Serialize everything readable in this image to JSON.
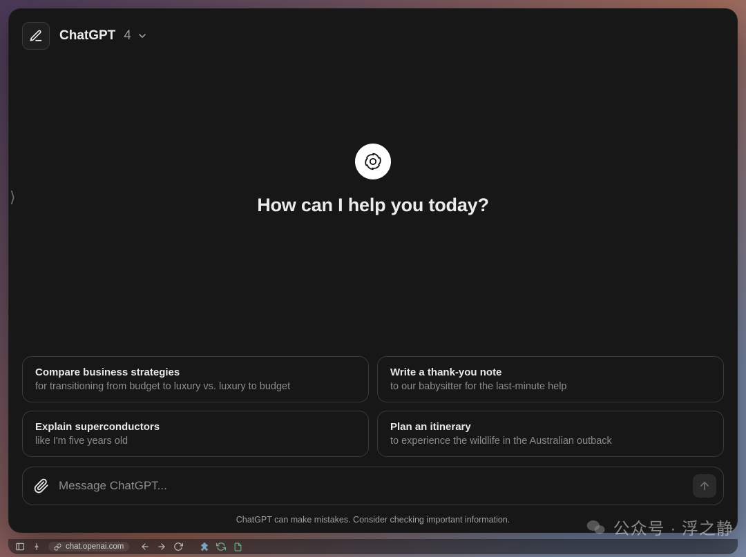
{
  "header": {
    "model_name": "ChatGPT",
    "model_version": "4"
  },
  "hero": {
    "heading": "How can I help you today?"
  },
  "suggestions": [
    {
      "title": "Compare business strategies",
      "subtitle": "for transitioning from budget to luxury vs. luxury to budget"
    },
    {
      "title": "Write a thank-you note",
      "subtitle": "to our babysitter for the last-minute help"
    },
    {
      "title": "Explain superconductors",
      "subtitle": "like I'm five years old"
    },
    {
      "title": "Plan an itinerary",
      "subtitle": "to experience the wildlife in the Australian outback"
    }
  ],
  "composer": {
    "placeholder": "Message ChatGPT..."
  },
  "disclaimer": "ChatGPT can make mistakes. Consider checking important information.",
  "browser": {
    "url": "chat.openai.com"
  },
  "watermark": {
    "text": "公众号 · 浮之静"
  }
}
